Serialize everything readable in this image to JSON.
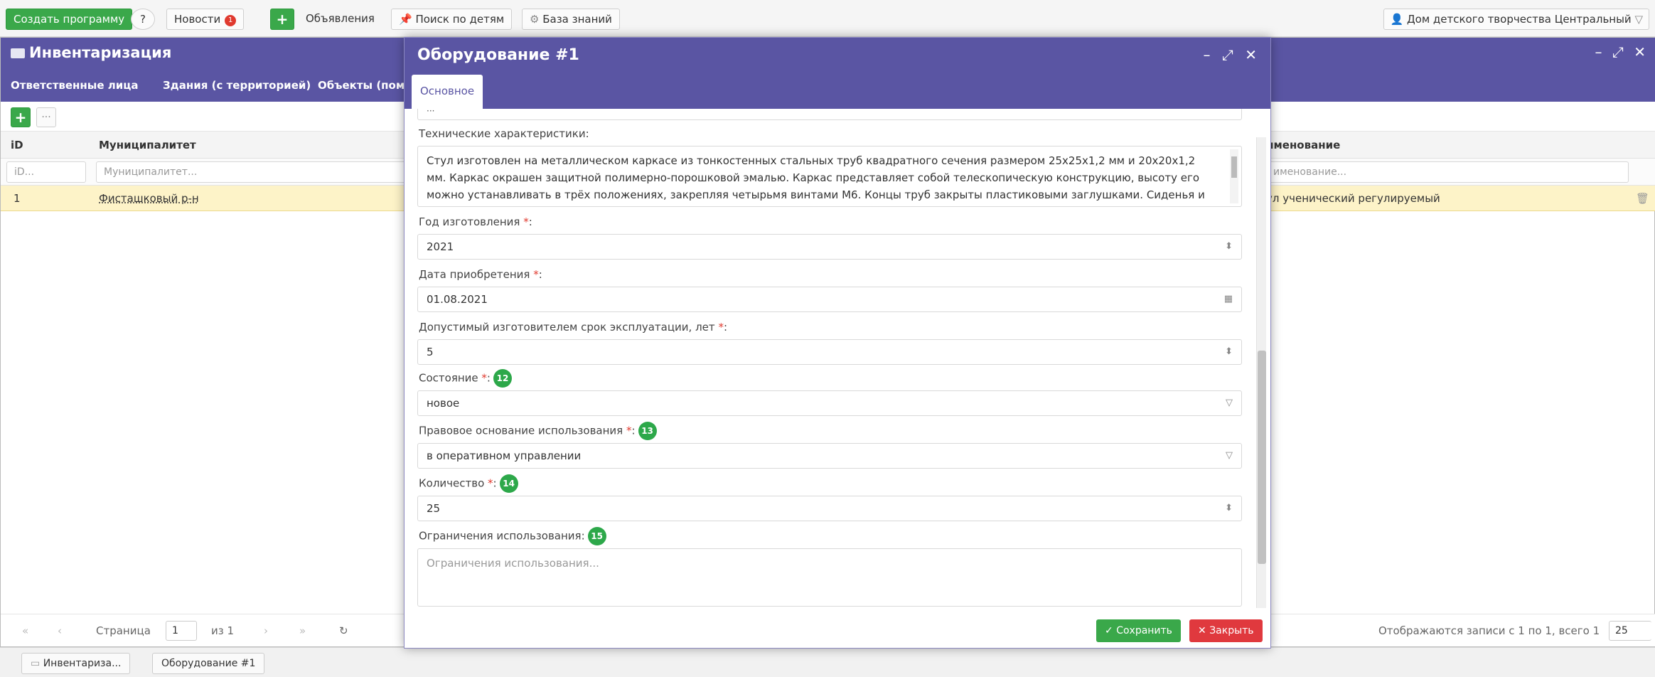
{
  "topbar": {
    "create_program": "Создать программу",
    "help_icon": "?",
    "news": "Новости",
    "news_badge": "1",
    "ads": "Объявления",
    "child_search": "Поиск по детям",
    "knowledge": "База знаний",
    "organization": "Дом детского творчества Центральный"
  },
  "window": {
    "title": "Инвентаризация",
    "tabs": [
      "Ответственные лица",
      "Здания (с территорией)",
      "Объекты (пом"
    ],
    "columns": {
      "id": "iD",
      "municipality": "Муниципалитет",
      "name": "именование"
    },
    "filters": {
      "id": "iD...",
      "municipality": "Муниципалитет...",
      "name": "именование..."
    },
    "rows": [
      {
        "id": "1",
        "municipality": "Фисташковый р-н",
        "name": "ул ученический регулируемый"
      }
    ],
    "pager": {
      "page_label": "Страница",
      "page": "1",
      "of": "из 1",
      "summary": "Отображаются записи с 1 по 1, всего 1",
      "per_page": "25"
    }
  },
  "taskbar": [
    "Инвентариза...",
    "Оборудование #1"
  ],
  "dialog": {
    "title": "Оборудование #1",
    "tab": "Основное",
    "fields": {
      "tech_label": "Технические характеристики:",
      "tech_value": "Стул изготовлен на металлическом каркасе из тонкостенных стальных труб квадратного сечения размером 25x25x1,2 мм и 20x20x1,2 мм. Каркас окрашен защитной полимерно-порошковой эмалью. Каркас представляет собой телескопическую конструкцию, высоту его можно устанавливать в трёх положениях, закрепляя четырьмя винтами М6. Концы труб закрыты пластиковыми заглушками. Сиденья и спинки стульев выполнены из объёмно-формованной гнутоклееной фанеры толщиной 9 мм со сферическим выжимом на сиденье, покрытой",
      "year_label": "Год изготовления",
      "year_value": "2021",
      "purchase_label": "Дата приобретения",
      "purchase_value": "01.08.2021",
      "life_label": "Допустимый изготовителем срок эксплуатации, лет",
      "life_value": "5",
      "state_label": "Состояние",
      "state_num": "12",
      "state_value": "новое",
      "legal_label": "Правовое основание использования",
      "legal_num": "13",
      "legal_value": "в оперативном управлении",
      "qty_label": "Количество",
      "qty_num": "14",
      "qty_value": "25",
      "limits_label": "Ограничения использования:",
      "limits_num": "15",
      "limits_placeholder": "Ограничения использования...",
      "required_mark": "*",
      "colon": ":"
    },
    "save": "Сохранить",
    "close": "Закрыть"
  },
  "colors": {
    "header": "#5a55a3",
    "success": "#3aa84a",
    "danger": "#e0393e",
    "badge_green": "#2da84a",
    "row_highlight": "#fdf3c8"
  }
}
